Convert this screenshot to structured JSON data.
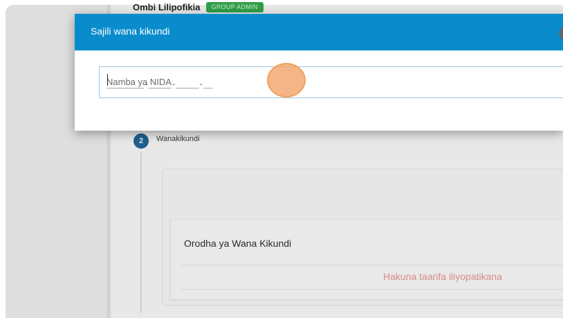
{
  "background": {
    "applicant_name": "Ombi Lilipofikia",
    "role_badge": "GROUP ADMIN",
    "step": {
      "number": "2",
      "label": "Wanakikundi"
    },
    "members_list": {
      "title": "Orodha ya Wana Kikundi",
      "empty_message": "Hakuna taarifa iliyopatikana"
    }
  },
  "modal": {
    "title": "Sajili wana kikundi",
    "nida_field": {
      "placeholder": "Namba ya NIDA",
      "value": "",
      "mask": "________-_____-_____-__"
    }
  },
  "colors": {
    "header_blue": "#0a8ccc",
    "badge_green": "#2f9e48",
    "step_blue": "#1f5f8e",
    "empty_text": "#d98a8a",
    "click_indicator": "#f4a064"
  }
}
